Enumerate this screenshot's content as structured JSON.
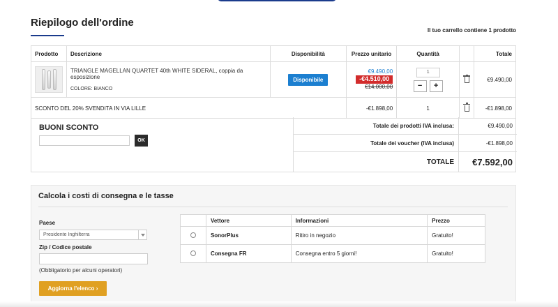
{
  "page": {
    "title": "Riepilogo dell'ordine",
    "cart_count": "Il tuo carrello contiene 1 prodotto"
  },
  "cart": {
    "headers": {
      "product": "Prodotto",
      "description": "Descrizione",
      "availability": "Disponibilità",
      "unit_price": "Prezzo unitario",
      "quantity": "Quantità",
      "total": "Totale"
    },
    "item": {
      "name": "TRIANGLE MAGELLAN QUARTET 40th WHITE SIDERAL, coppia da esposizione",
      "color": "COLORE: BIANCO",
      "availability": "Disponibile",
      "price_new": "€9.490,00",
      "price_discount": "-€4.510,00",
      "price_old": "€14.000,00",
      "quantity": "1",
      "qty_minus": "−",
      "qty_plus": "+",
      "total": "€9.490,00"
    },
    "discount": {
      "label": "SCONTO DEL 20% SVENDITA IN VIA LILLE",
      "unit": "-€1.898,00",
      "quantity": "1",
      "total": "-€1.898,00"
    }
  },
  "coupon": {
    "title": "BUONI SCONTO",
    "input_value": "",
    "ok_label": "OK"
  },
  "totals": {
    "products_label": "Totale dei prodotti IVA inclusa:",
    "products_value": "€9.490,00",
    "vouchers_label": "Totale dei voucher (IVA inclusa)",
    "vouchers_value": "-€1.898,00",
    "total_label": "TOTALE",
    "total_value": "€7.592,00"
  },
  "shipping": {
    "title": "Calcola i costi di consegna e le tasse",
    "country_label": "Paese",
    "country_value": "Presidente Inghilterra",
    "zip_label": "Zip / Codice postale",
    "zip_value": "",
    "zip_note": "(Obbligatorio per alcuni operatori)",
    "update_label": "Aggiorna l'elenco",
    "update_chevron": "›",
    "headers": {
      "select": "",
      "carrier": "Vettore",
      "info": "Informazioni",
      "price": "Prezzo"
    },
    "carriers": [
      {
        "name": "SonorPlus",
        "info": "Ritiro in negozio",
        "price": "Gratuito!"
      },
      {
        "name": "Consegna FR",
        "info": "Consegna entro 5 giorni!",
        "price": "Gratuito!"
      }
    ]
  },
  "colors": {
    "accent_blue": "#1c7fd0",
    "title_underline": "#1a3b8c",
    "discount_red": "#d22c2c",
    "update_button": "#e0a022"
  },
  "icons": [
    "trash-icon",
    "radio-button",
    "dropdown-arrow-icon",
    "chevron-right-icon"
  ]
}
